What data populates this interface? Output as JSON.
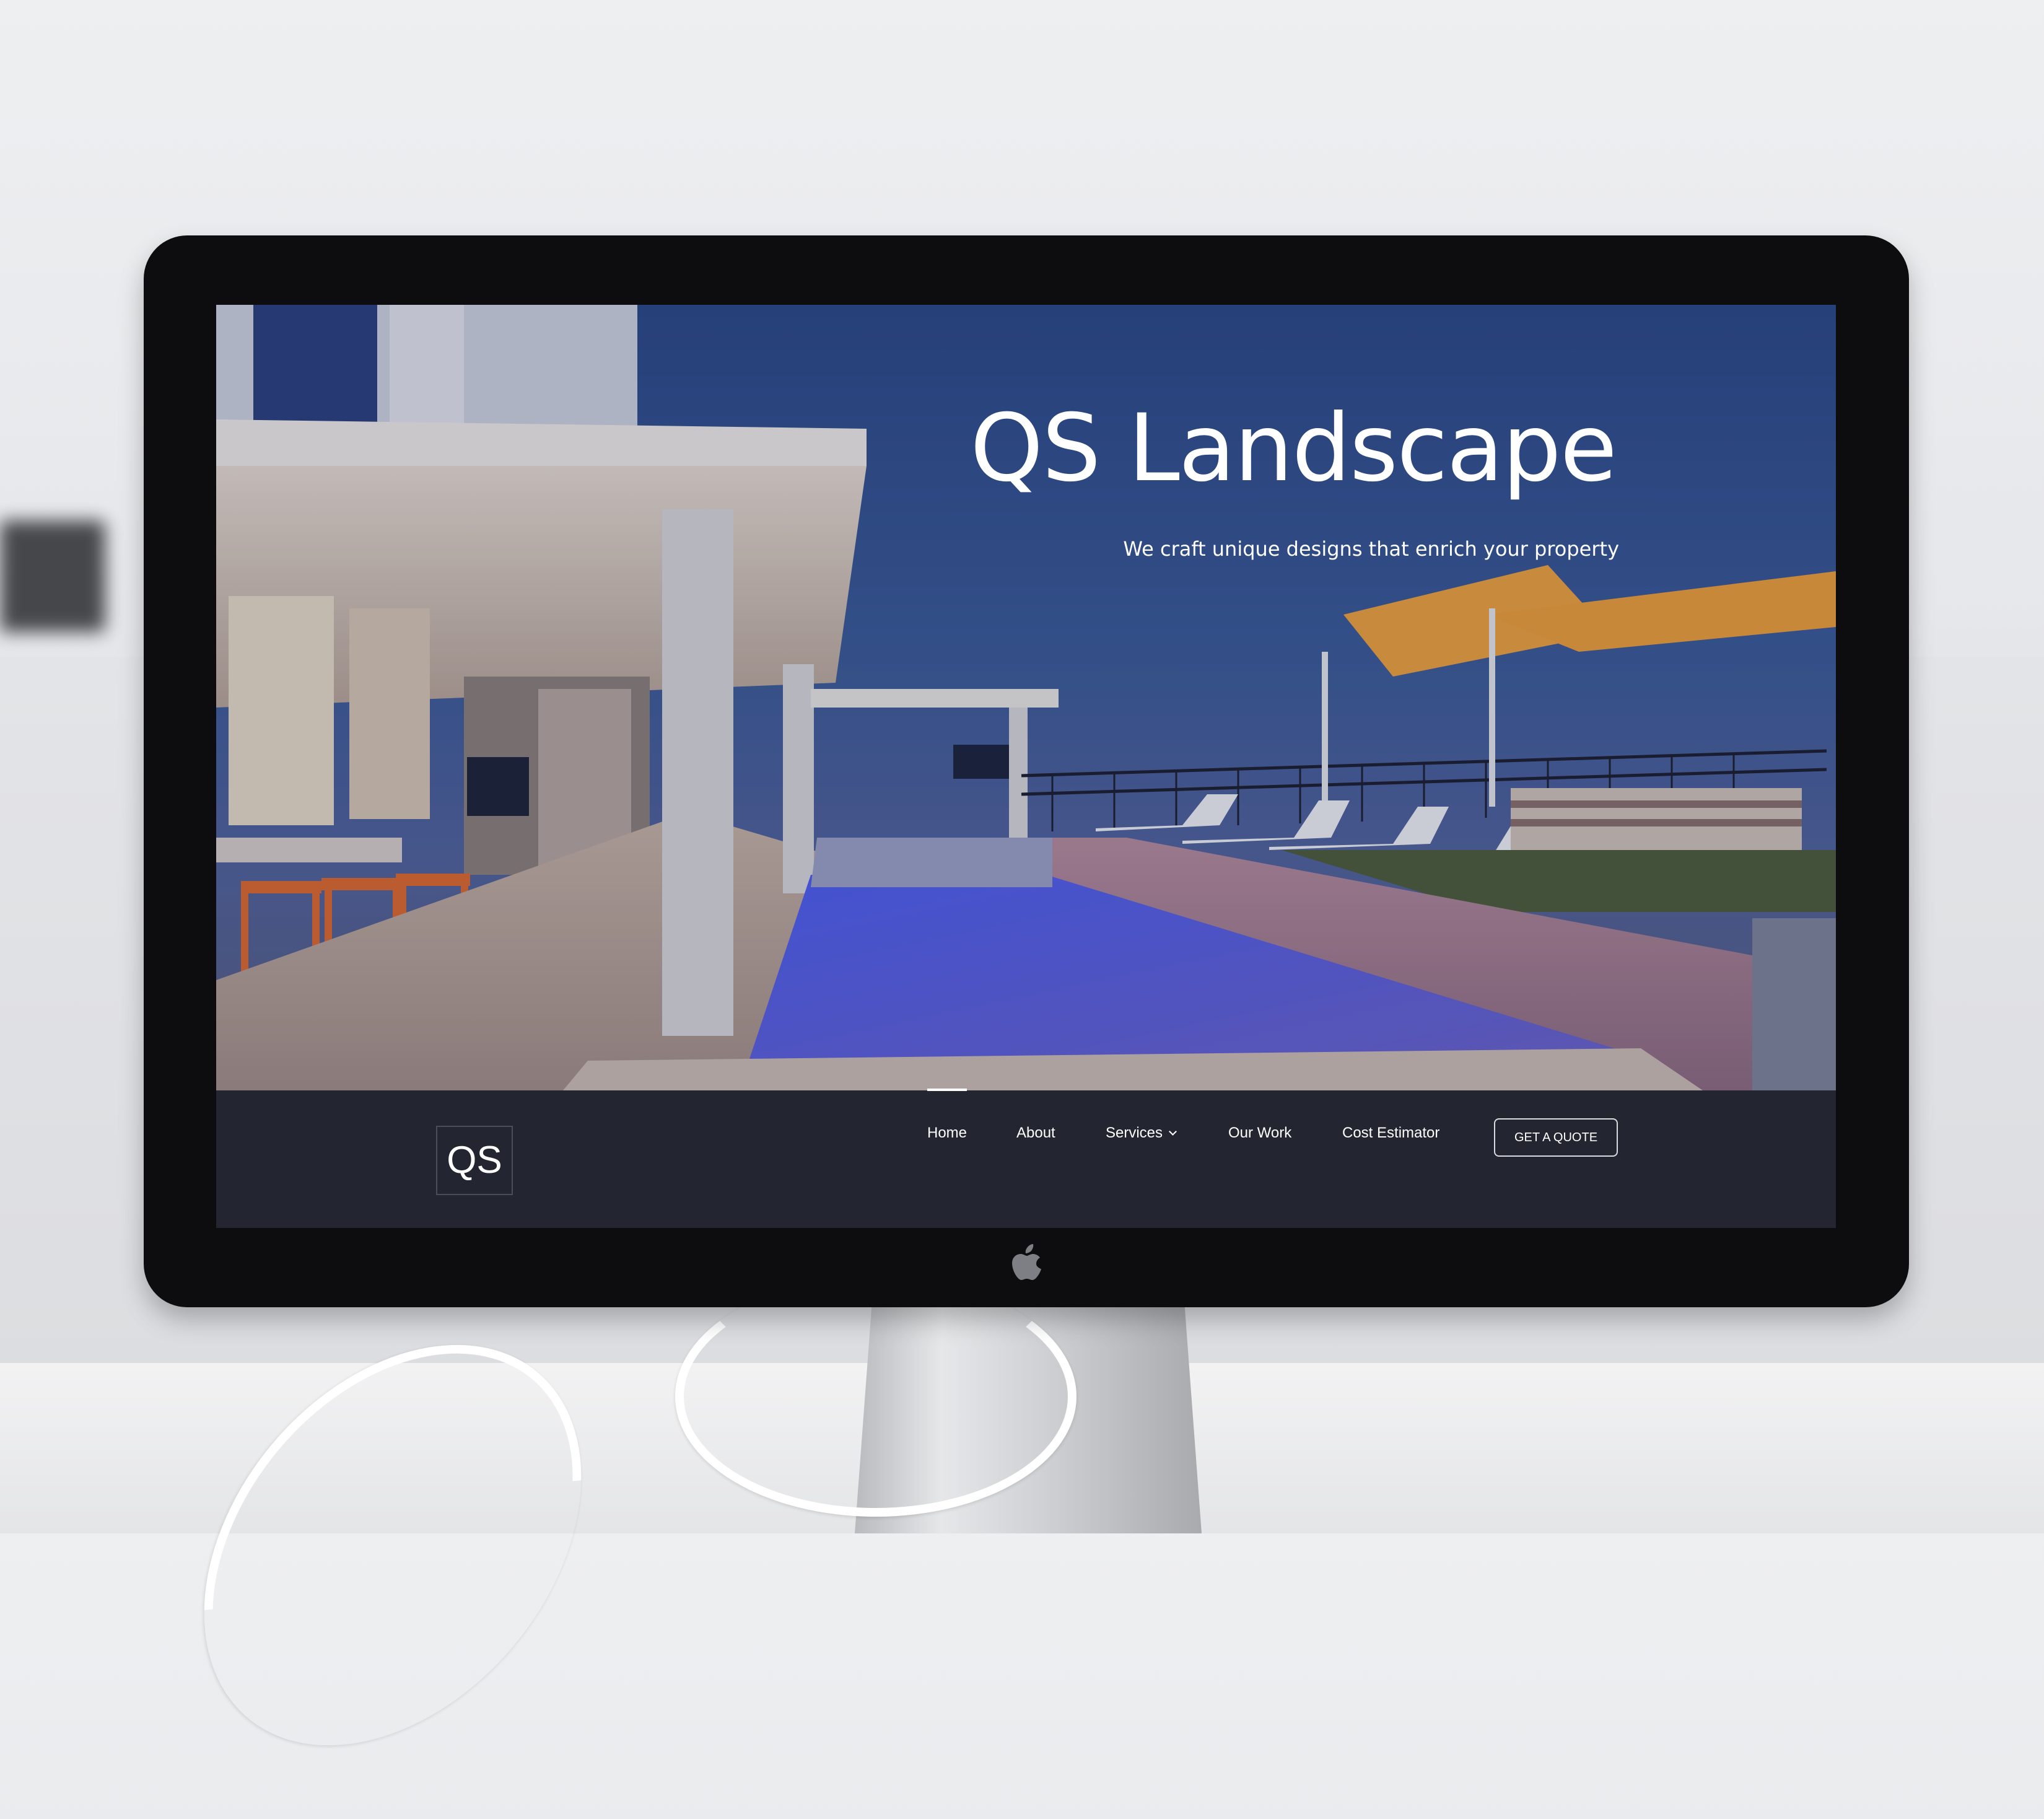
{
  "site": {
    "hero": {
      "title": "QS Landscape",
      "subtitle": "We craft unique designs that enrich your property"
    },
    "logo": "QS",
    "nav": {
      "items": [
        {
          "label": "Home",
          "active": true
        },
        {
          "label": "About"
        },
        {
          "label": "Services",
          "has_dropdown": true
        },
        {
          "label": "Our Work"
        },
        {
          "label": "Cost Estimator"
        }
      ],
      "cta_label": "GET A QUOTE"
    }
  },
  "colors": {
    "navbar_bg": "#232630",
    "hero_sky": "#2a4785",
    "pool": "#4f58e0",
    "umbrella": "#f0a23a"
  },
  "icons": [
    "apple-logo-icon",
    "chevron-down-icon"
  ]
}
